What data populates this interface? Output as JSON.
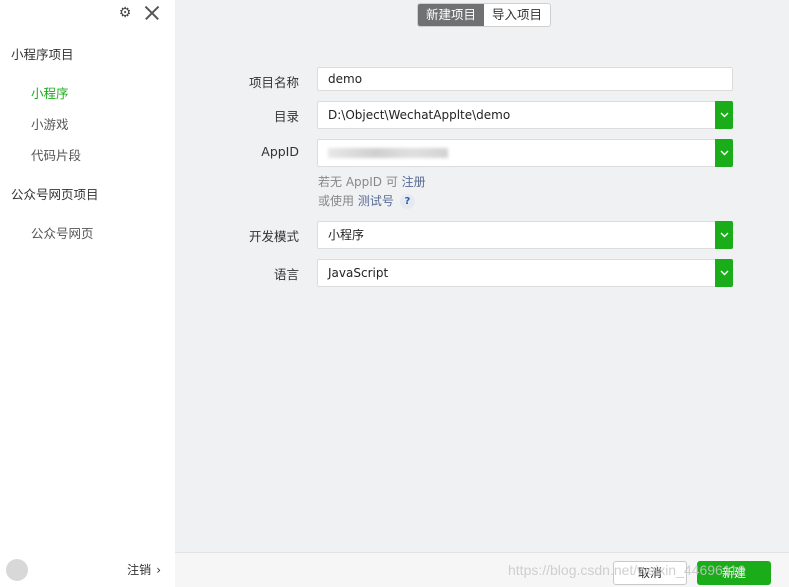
{
  "sidebar": {
    "section1_title": "小程序项目",
    "items1": [
      {
        "label": "小程序"
      },
      {
        "label": "小游戏"
      },
      {
        "label": "代码片段"
      }
    ],
    "section2_title": "公众号网页项目",
    "items2": [
      {
        "label": "公众号网页"
      }
    ],
    "logout_label": "注销",
    "logout_chevron": "›"
  },
  "tabs": [
    {
      "label": "新建项目"
    },
    {
      "label": "导入项目"
    }
  ],
  "form": {
    "name_label": "项目名称",
    "name_value": "demo",
    "dir_label": "目录",
    "dir_value": "D:\\Object\\WechatApplte\\demo",
    "appid_label": "AppID",
    "hint1_prefix": "若无 AppID 可 ",
    "hint1_link": "注册",
    "hint2_prefix": "或使用 ",
    "hint2_link": "测试号",
    "help_glyph": "?",
    "mode_label": "开发模式",
    "mode_value": "小程序",
    "lang_label": "语言",
    "lang_value": "JavaScript"
  },
  "footer": {
    "cancel_label": "取消",
    "create_label": "新建",
    "watermark": "https://blog.csdn.net/weixin_44696116"
  },
  "colors": {
    "accent": "#1aad19",
    "link": "#576b95",
    "active_tab": "#6f7173"
  },
  "icons": {
    "gear": "settings-gear-icon",
    "close": "close-icon",
    "caret": "chevron-down-icon"
  }
}
